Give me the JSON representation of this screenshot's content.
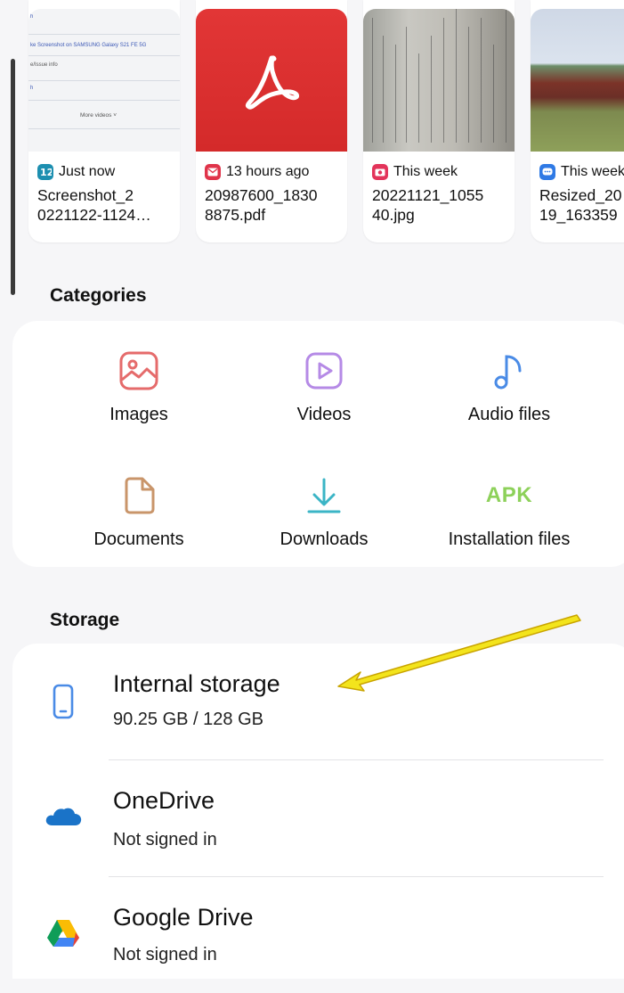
{
  "recent_files": [
    {
      "time": "Just now",
      "name_lines": [
        "Screenshot_2",
        "0221122-1124…"
      ],
      "app_icon": "screenshot-app-icon",
      "app_color": "#1d8fb0",
      "thumb_type": "screenshot",
      "thumb_text": [
        "ke Screenshot on SAMSUNG Galaxy S21 FE 5G",
        "e/Issue info",
        "h"
      ],
      "thumb_more": "More videos  ˅"
    },
    {
      "time": "13 hours ago",
      "name_lines": [
        "20987600_1830",
        "8875.pdf"
      ],
      "app_icon": "email-app-icon",
      "app_color": "#e0344a",
      "thumb_type": "pdf"
    },
    {
      "time": "This week",
      "name_lines": [
        "20221121_1055",
        "40.jpg"
      ],
      "app_icon": "camera-app-icon",
      "app_color": "#e3345a",
      "thumb_type": "photo-book"
    },
    {
      "time": "This week",
      "name_lines": [
        "Resized_20",
        "19_163359"
      ],
      "app_icon": "messages-app-icon",
      "app_color": "#2f7ae5",
      "thumb_type": "photo-field"
    }
  ],
  "categories_title": "Categories",
  "categories": [
    {
      "label": "Images",
      "icon": "images-icon",
      "color": "#e56b6b"
    },
    {
      "label": "Videos",
      "icon": "videos-icon",
      "color": "#b58ae6"
    },
    {
      "label": "Audio files",
      "icon": "audio-icon",
      "color": "#4a8be6"
    },
    {
      "label": "Documents",
      "icon": "documents-icon",
      "color": "#c9956a"
    },
    {
      "label": "Downloads",
      "icon": "downloads-icon",
      "color": "#3bb5c6"
    },
    {
      "label": "Installation files",
      "icon": "apk-icon",
      "icon_text": "APK",
      "color": "#8dd15a"
    }
  ],
  "storage_title": "Storage",
  "storage": [
    {
      "title": "Internal storage",
      "subtitle": "90.25 GB / 128 GB",
      "icon": "phone-icon"
    },
    {
      "title": "OneDrive",
      "subtitle": "Not signed in",
      "icon": "onedrive-icon"
    },
    {
      "title": "Google Drive",
      "subtitle": "Not signed in",
      "icon": "google-drive-icon"
    }
  ],
  "colors": {
    "background": "#f6f6f8",
    "panel": "#ffffff",
    "annotation_arrow": "#f3e41c"
  }
}
